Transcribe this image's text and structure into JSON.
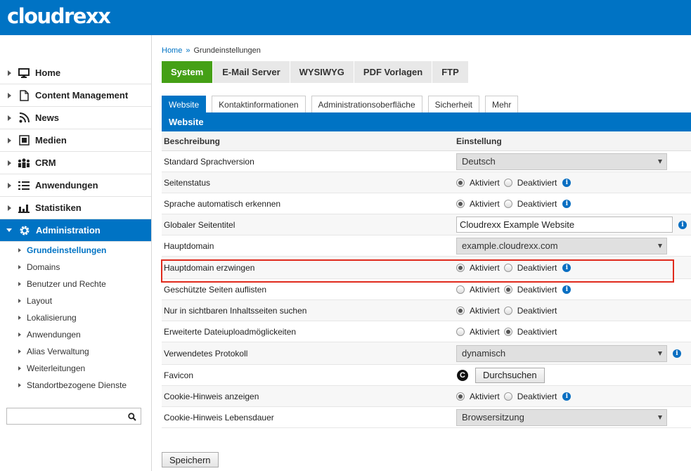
{
  "app": {
    "logo": "cloudrexx"
  },
  "sidebar": {
    "items": [
      {
        "label": "Home",
        "icon": "monitor-icon"
      },
      {
        "label": "Content Management",
        "icon": "document-icon"
      },
      {
        "label": "News",
        "icon": "rss-icon"
      },
      {
        "label": "Medien",
        "icon": "media-icon"
      },
      {
        "label": "CRM",
        "icon": "people-icon"
      },
      {
        "label": "Anwendungen",
        "icon": "list-icon"
      },
      {
        "label": "Statistiken",
        "icon": "bar-chart-icon"
      },
      {
        "label": "Administration",
        "icon": "gear-icon",
        "active": true
      }
    ],
    "subitems": [
      "Grundeinstellungen",
      "Domains",
      "Benutzer und Rechte",
      "Layout",
      "Lokalisierung",
      "Anwendungen",
      "Alias Verwaltung",
      "Weiterleitungen",
      "Standortbezogene Dienste"
    ],
    "search_value": ""
  },
  "breadcrumb": {
    "home": "Home",
    "sep": "»",
    "current": "Grundeinstellungen"
  },
  "tabs": [
    "System",
    "E-Mail Server",
    "WYSIWYG",
    "PDF Vorlagen",
    "FTP"
  ],
  "subtabs": [
    "Website",
    "Kontaktinformationen",
    "Administrationsoberfläche",
    "Sicherheit",
    "Mehr"
  ],
  "section_title": "Website",
  "table": {
    "col_desc": "Beschreibung",
    "col_setting": "Einstellung",
    "on": "Aktiviert",
    "off": "Deaktiviert",
    "rows": [
      {
        "label": "Standard Sprachversion",
        "value": "Deutsch"
      },
      {
        "label": "Seitenstatus"
      },
      {
        "label": "Sprache automatisch erkennen"
      },
      {
        "label": "Globaler Seitentitel",
        "value": "Cloudrexx Example Website"
      },
      {
        "label": "Hauptdomain",
        "value": "example.cloudrexx.com"
      },
      {
        "label": "Hauptdomain erzwingen"
      },
      {
        "label": "Geschützte Seiten auflisten"
      },
      {
        "label": "Nur in sichtbaren Inhaltsseiten suchen"
      },
      {
        "label": "Erweiterte Dateiuploadmöglickeiten"
      },
      {
        "label": "Verwendetes Protokoll",
        "value": "dynamisch"
      },
      {
        "label": "Favicon",
        "button": "Durchsuchen"
      },
      {
        "label": "Cookie-Hinweis anzeigen"
      },
      {
        "label": "Cookie-Hinweis Lebensdauer",
        "value": "Browsersitzung"
      }
    ]
  },
  "save_label": "Speichern",
  "colors": {
    "brand": "#0073c4",
    "active_tab": "#45a016",
    "highlight": "#e02a1c"
  }
}
